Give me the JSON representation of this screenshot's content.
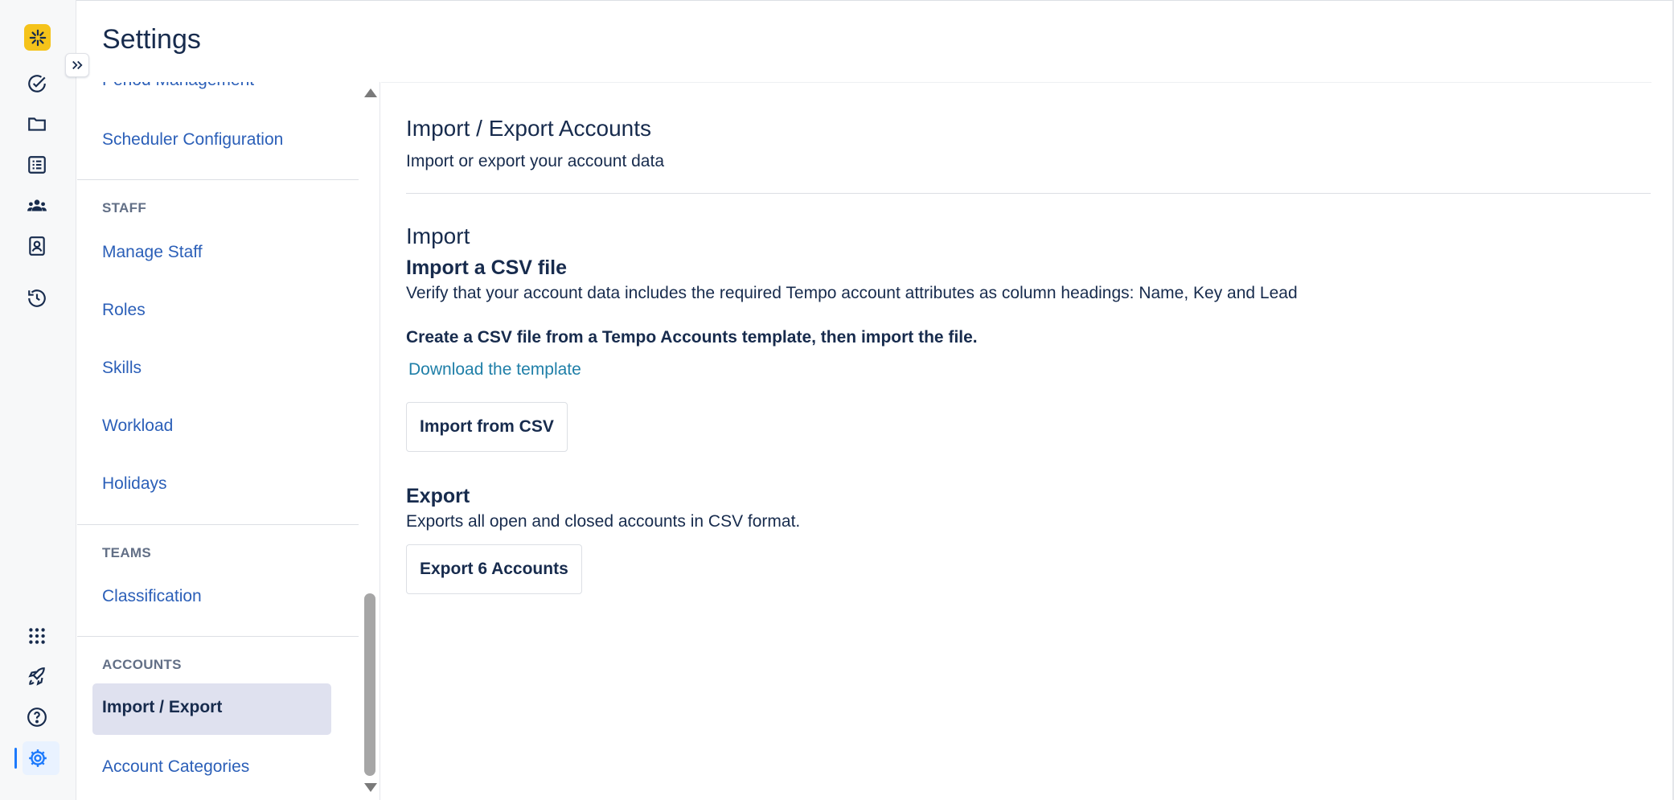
{
  "app": {
    "page_title": "Settings"
  },
  "rail": {
    "icons": [
      "tempo-logo-icon",
      "check-circle-icon",
      "folder-icon",
      "list-icon",
      "team-icon",
      "contact-card-icon",
      "history-icon",
      "apps-grid-icon",
      "rocket-icon",
      "help-icon",
      "settings-gear-icon"
    ],
    "active": "settings-gear-icon",
    "accent_color": "#1d7afc",
    "logo_color": "#f5c31a"
  },
  "sidebar": {
    "partial_top_item": "Period Management",
    "scheduler_item": "Scheduler Configuration",
    "staff_section": "STAFF",
    "staff_items": [
      "Manage Staff",
      "Roles",
      "Skills",
      "Workload",
      "Holidays"
    ],
    "teams_section": "TEAMS",
    "teams_items": [
      "Classification"
    ],
    "accounts_section": "ACCOUNTS",
    "active_item": "Import / Export",
    "accounts_items": [
      "Account Categories"
    ],
    "link_color": "#2b5fb8",
    "active_bg": "#dfe1ef"
  },
  "main": {
    "title": "Import / Export Accounts",
    "subtitle": "Import or export your account data",
    "import": {
      "heading": "Import",
      "subheading": "Import a CSV file",
      "description": "Verify that your account data includes the required Tempo account attributes as column headings: Name, Key and Lead",
      "instruction": "Create a CSV file from a Tempo Accounts template, then import the file.",
      "template_link": "Download the template",
      "button_label": "Import from CSV"
    },
    "export": {
      "heading": "Export",
      "description": "Exports all open and closed accounts in CSV format.",
      "button_label": "Export 6 Accounts"
    }
  }
}
